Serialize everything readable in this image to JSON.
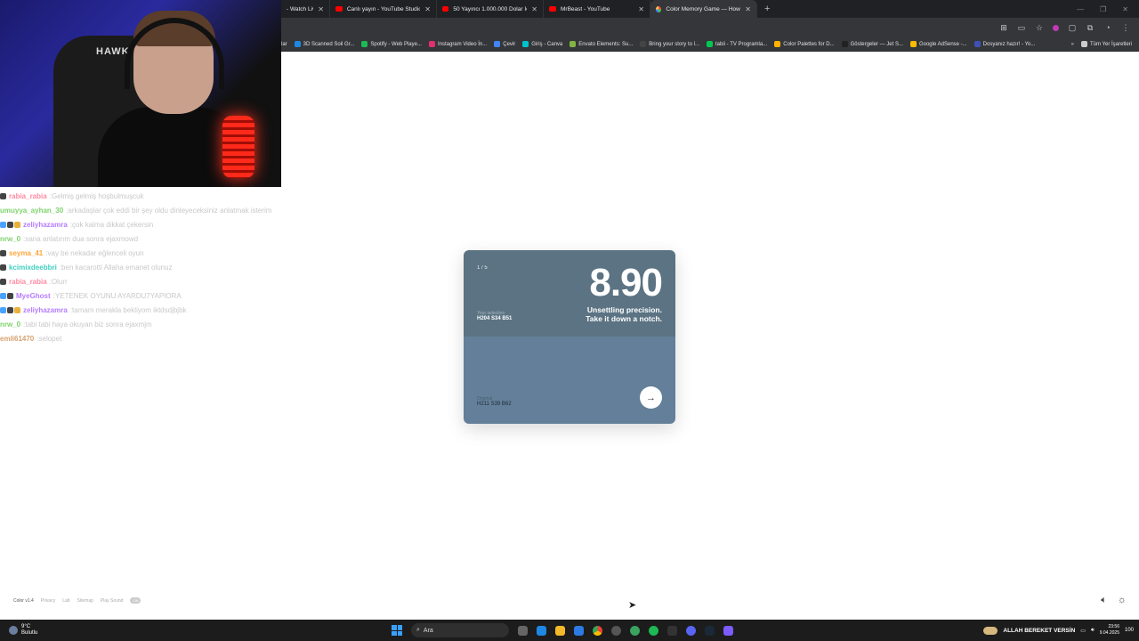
{
  "browser": {
    "tabs": [
      {
        "label": "- Watch Live",
        "favicon_color": "#ff0000"
      },
      {
        "label": "Canlı yayın - YouTube Studio",
        "favicon_color": "#ff0000"
      },
      {
        "label": "50 Yayıncı 1.000.000 Dolar İçin",
        "favicon_color": "#ff0000"
      },
      {
        "label": "MrBeast - YouTube",
        "favicon_color": "#ff0000"
      },
      {
        "label": "Color Memory Game — How W",
        "favicon_color": "#888888",
        "active": true
      }
    ],
    "new_tab": "+",
    "bookmarks": [
      {
        "label": "3D Scanned Soil Gr...",
        "color": "#1e88e5"
      },
      {
        "label": "Spotify - Web Playe...",
        "color": "#1db954"
      },
      {
        "label": "Instagram Video İn...",
        "color": "#e1306c"
      },
      {
        "label": "Çevir",
        "color": "#4285f4"
      },
      {
        "label": "Giriş - Canva",
        "color": "#00c4cc"
      },
      {
        "label": "Envato Elements: Su...",
        "color": "#82b541"
      },
      {
        "label": "Bring your story to l...",
        "color": "#444444"
      },
      {
        "label": "tabii - TV Programla...",
        "color": "#00c853"
      },
      {
        "label": "Color Palettes for D...",
        "color": "#ffb300"
      },
      {
        "label": "Göstergeler — Jet S...",
        "color": "#222222"
      },
      {
        "label": "Google AdSense -...",
        "color": "#fbbc04"
      },
      {
        "label": "Dosyanız hazır! - Yo...",
        "color": "#3f51b5"
      }
    ],
    "bookmarks_more": "»",
    "all_bookmarks": "Tüm Yer İşaretleri"
  },
  "chat": [
    {
      "user": "rabia_rabia",
      "user_color": "#ff8aa0",
      "badges": [
        "#444"
      ],
      "message": "Gelmiş gelmiş hoşbulmuşcuk"
    },
    {
      "user": "umuyya_ayhan_30",
      "user_color": "#7fd36b",
      "badges": [],
      "message": "arkadaşlar çok eddi bir şey oldu dinleyeceksiniz anlatmak isterim"
    },
    {
      "user": "zeliyhazamra",
      "user_color": "#b57cff",
      "badges": [
        "#4aa3ff",
        "#444",
        "#e8b23a"
      ],
      "message": "çok kalma dikkat çekersin"
    },
    {
      "user": "nrw_0",
      "user_color": "#7fd36b",
      "badges": [],
      "message": "sana anlatırım dua sonra ejaxmowd"
    },
    {
      "user": "seyma_41",
      "user_color": "#ffa53b",
      "badges": [
        "#444"
      ],
      "message": "vay be nekadar eğlenceli oyun"
    },
    {
      "user": "kcimixdeebbri",
      "user_color": "#3fd0c0",
      "badges": [
        "#444"
      ],
      "message": "ben kacarotti Allaha emanet olunuz"
    },
    {
      "user": "rabia_rabia",
      "user_color": "#ff8aa0",
      "badges": [
        "#444"
      ],
      "message": "Olurr"
    },
    {
      "user": "MyeGhost",
      "user_color": "#b57cff",
      "badges": [
        "#4aa3ff",
        "#444"
      ],
      "message": "YETENEK OYUNU AYARDU7YAPIORA"
    },
    {
      "user": "zeliyhazamra",
      "user_color": "#b57cff",
      "badges": [
        "#4aa3ff",
        "#444",
        "#e8b23a"
      ],
      "message": "tamam merakla bekliyom iktdsdjbjbk"
    },
    {
      "user": "nrw_0",
      "user_color": "#7fd36b",
      "badges": [],
      "message": "tabi tabi haya okuyan biz sonra ejaxmjm"
    },
    {
      "user": "emli61470",
      "user_color": "#d8a070",
      "badges": [],
      "message": "selopet"
    }
  ],
  "game": {
    "counter": "1 / 5",
    "score": "8.90",
    "feedback_line1": "Unsettling precision.",
    "feedback_line2": "Take it down a notch.",
    "selection_label": "Your selection",
    "selection_value": "H204 S34 B51",
    "original_label": "Original",
    "original_value": "H211 S39 B62",
    "selection_color": "#5b7383",
    "original_color": "#637f99"
  },
  "page_footer": {
    "version": "Color v1.4",
    "links": [
      "Privacy",
      "Lab",
      "Sitemap",
      "Play Sound"
    ],
    "pill": "ON"
  },
  "taskbar": {
    "weather_temp": "9°C",
    "weather_text": "Bulutlu",
    "search_placeholder": "Ara",
    "tray_text": "ALLAH BEREKET VERSİN",
    "time": "23:56",
    "date": "9.04.2025",
    "notification_count": "100"
  }
}
